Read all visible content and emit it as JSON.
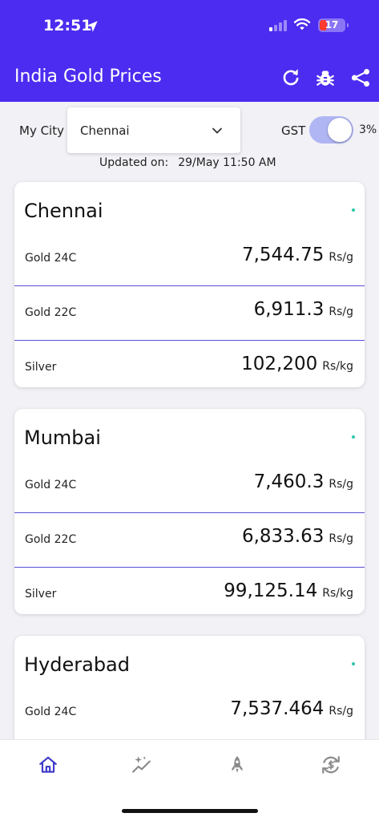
{
  "status_bar": {
    "time": "12:51",
    "battery": "17"
  },
  "app_bar": {
    "title": "India Gold Prices",
    "icons": [
      "refresh-icon",
      "bug-icon",
      "share-icon"
    ]
  },
  "controls": {
    "city_label": "My City",
    "city_value": "Chennai",
    "gst_label": "GST",
    "gst_enabled": true,
    "gst_percent": "3%",
    "updated_label": "Updated on:",
    "updated_value": "29/May 11:50 AM"
  },
  "cards": [
    {
      "city": "Chennai",
      "rows": [
        {
          "name": "Gold 24C",
          "value": "7,544.75",
          "unit": "Rs/g"
        },
        {
          "name": "Gold 22C",
          "value": "6,911.3",
          "unit": "Rs/g"
        },
        {
          "name": "Silver",
          "value": "102,200",
          "unit": "Rs/kg"
        }
      ]
    },
    {
      "city": "Mumbai",
      "rows": [
        {
          "name": "Gold 24C",
          "value": "7,460.3",
          "unit": "Rs/g"
        },
        {
          "name": "Gold 22C",
          "value": "6,833.63",
          "unit": "Rs/g"
        },
        {
          "name": "Silver",
          "value": "99,125.14",
          "unit": "Rs/kg"
        }
      ]
    },
    {
      "city": "Hyderabad",
      "rows": [
        {
          "name": "Gold 24C",
          "value": "7,537.464",
          "unit": "Rs/g"
        }
      ]
    }
  ],
  "nav": {
    "items": [
      "home-icon",
      "sparkle-chart-icon",
      "rocket-icon",
      "currency-exchange-icon"
    ],
    "active": "home-icon"
  },
  "colors": {
    "primary": "#4c2cf0",
    "divider": "#5a4fd6",
    "nav_active": "#3f3ac9",
    "nav_inactive": "#8a8a8a"
  }
}
